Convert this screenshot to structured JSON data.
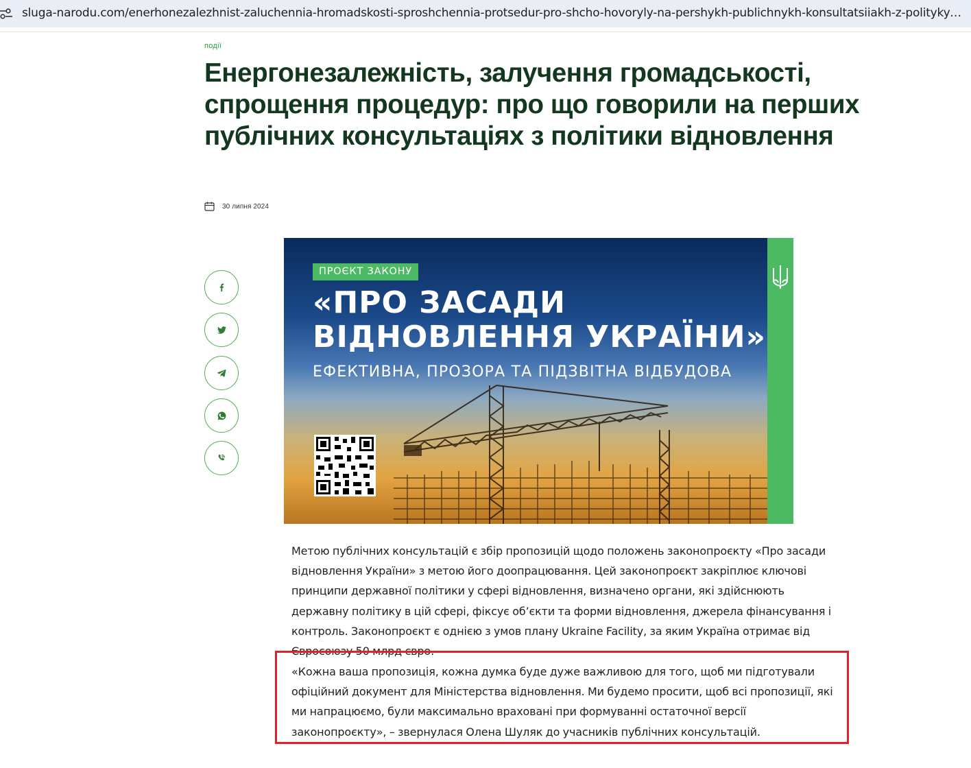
{
  "browser": {
    "url": "sluga-narodu.com/enerhonezalezhnist-zaluchennia-hromadskosti-sproshchennia-protsedur-pro-shcho-hovoryly-na-pershykh-publichnykh-konsultatsiiakh-z-polityky-vidnovlen…"
  },
  "article": {
    "category": "події",
    "title": "Енергонезалежність, залучення громадськості, спрощення процедур: про що говорили на перших публічних консультаціях з політики відновлення",
    "date": "30 липня 2024",
    "paragraph1": "Метою публічних консультацій є збір пропозицій щодо положень законопроєкту «Про засади відновлення України» з метою його доопрацювання. Цей законопроєкт закріплює ключові принципи державної політики у сфері відновлення, визначено органи, які здійснюють державну політику в цій сфері, фіксує об’єкти та форми відновлення, джерела фінансування і контроль. Законопроєкт є однією з умов плану Ukraine Facility, за яким Україна отримає від Євросоюзу 50 млрд євро.",
    "paragraph2": "«Кожна ваша пропозиція, кожна думка буде дуже важливою для того, щоб ми підготували офіційний документ для Міністерства відновлення. Ми будемо просити, щоб всі пропозиції, які ми напрацюємо, були максимально враховані при формуванні остаточної версії законопроєкту», – звернулася Олена Шуляк до учасників публічних консультацій."
  },
  "banner": {
    "tag": "ПРОЄКТ ЗАКОНУ",
    "title_line1": "«ПРО ЗАСАДИ",
    "title_line2": "ВІДНОВЛЕННЯ УКРАЇНИ»",
    "subtitle": "ЕФЕКТИВНА, ПРОЗОРА ТА ПІДЗВІТНА ВІДБУДОВА"
  },
  "share": [
    {
      "icon": "facebook-icon"
    },
    {
      "icon": "twitter-icon"
    },
    {
      "icon": "telegram-icon"
    },
    {
      "icon": "whatsapp-icon"
    },
    {
      "icon": "viber-icon"
    }
  ],
  "colors": {
    "accent_green": "#4cb963",
    "title_dark_green": "#14381f",
    "highlight_red": "#e3202b"
  }
}
